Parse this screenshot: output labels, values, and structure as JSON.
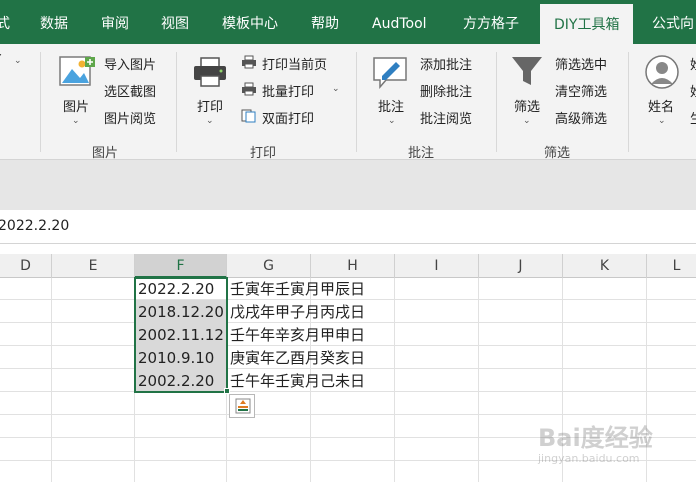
{
  "tabs": [
    {
      "label": "式",
      "active": false
    },
    {
      "label": "数据",
      "active": false
    },
    {
      "label": "审阅",
      "active": false
    },
    {
      "label": "视图",
      "active": false
    },
    {
      "label": "模板中心",
      "active": false
    },
    {
      "label": "帮助",
      "active": false
    },
    {
      "label": "AudTool",
      "active": false
    },
    {
      "label": "方方格子",
      "active": false
    },
    {
      "label": "DIY工具箱",
      "active": true
    },
    {
      "label": "公式向",
      "active": false
    }
  ],
  "ribbon": {
    "group_picture": {
      "label": "图片",
      "big_button": "图片",
      "items": [
        "导入图片",
        "选区截图",
        "图片阅览"
      ]
    },
    "group_print": {
      "label": "打印",
      "big_button": "打印",
      "items": [
        "打印当前页",
        "批量打印",
        "双面打印"
      ]
    },
    "group_comment": {
      "label": "批注",
      "big_button": "批注",
      "items": [
        "添加批注",
        "删除批注",
        "批注阅览"
      ]
    },
    "group_filter": {
      "label": "筛选",
      "big_button": "筛选",
      "items": [
        "筛选选中",
        "清空筛选",
        "高级筛选"
      ]
    },
    "group_name": {
      "big_button": "姓名"
    }
  },
  "formula_bar": {
    "value": "2022.2.20"
  },
  "columns": [
    "D",
    "E",
    "F",
    "G",
    "H",
    "I",
    "J",
    "K",
    "L"
  ],
  "selected_column": "F",
  "rows": [
    {
      "date": "2022.2.20",
      "ganzhi": "壬寅年壬寅月甲辰日"
    },
    {
      "date": "2018.12.20",
      "ganzhi": "戊戌年甲子月丙戌日"
    },
    {
      "date": "2002.11.12",
      "ganzhi": "壬午年辛亥月甲申日"
    },
    {
      "date": "2010.9.10",
      "ganzhi": "庚寅年乙酉月癸亥日"
    },
    {
      "date": "2002.2.20",
      "ganzhi": "壬午年壬寅月己未日"
    }
  ],
  "watermark": {
    "brand": "Bai度经验",
    "url": "jingyan.baidu.com"
  },
  "colors": {
    "accent": "#217346",
    "ribbon_bg": "#f3f3f3",
    "selection": "#d9d9d9"
  },
  "icons": [
    "picture-icon",
    "printer-icon",
    "print-page-icon",
    "batch-print-icon",
    "duplex-print-icon",
    "comment-icon",
    "funnel-icon",
    "person-icon",
    "quick-analysis-icon"
  ]
}
